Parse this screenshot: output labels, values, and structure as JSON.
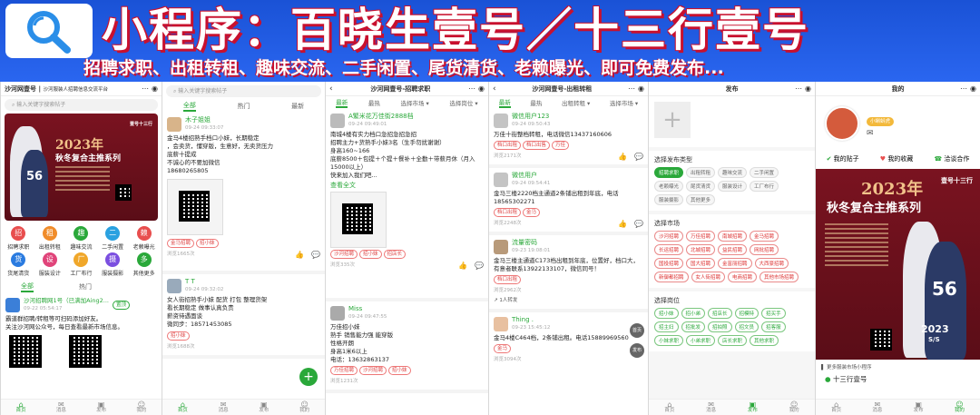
{
  "banner": {
    "headline": "小程序：百晓生壹号／十三行壹号",
    "subline": "招聘求职、出租转租、趣味交流、二手闲置、尾货清货、老赖曝光、即可免费发布..."
  },
  "common": {
    "tabs": [
      "全部",
      "热门",
      "最新"
    ],
    "tabbar": [
      "首页",
      "消息",
      "发布",
      "我的"
    ],
    "like_icon": "👍",
    "comment_icon": "💬"
  },
  "p1": {
    "title": "沙河网壹号",
    "title_sep": "|",
    "title_rest": "沙河服装人招聘信息交流平台",
    "search_placeholder": "输入关键字搜索帖子",
    "poster": {
      "year": "2023年",
      "headline": "秋冬复合主推系列",
      "brand": "壹号十三行",
      "number": "56"
    },
    "grid": [
      {
        "label": "招聘求职",
        "color": "#e84e4e",
        "icon": "招"
      },
      {
        "label": "出租转租",
        "color": "#f08c2a",
        "icon": "租"
      },
      {
        "label": "趣味交流",
        "color": "#2aa83a",
        "icon": "趣"
      },
      {
        "label": "二手闲置",
        "color": "#2aa1e0",
        "icon": "二"
      },
      {
        "label": "老赖曝光",
        "color": "#e84e4e",
        "icon": "赖"
      },
      {
        "label": "货尾清货",
        "color": "#2a7be0",
        "icon": "货"
      },
      {
        "label": "服装设计",
        "color": "#e0447a",
        "icon": "设"
      },
      {
        "label": "工厂布行",
        "color": "#f0a72a",
        "icon": "厂"
      },
      {
        "label": "服装摄影",
        "color": "#7b4fe0",
        "icon": "摄"
      },
      {
        "label": "其他更多",
        "color": "#2aa83a",
        "icon": "多"
      }
    ],
    "tabs": [
      "全部",
      "热门"
    ],
    "post": {
      "name": "沙河招聘网1号（已满加Aing2...",
      "badge": "置顶",
      "time": "09-22 05:54:17",
      "line1": "霸道群招聘/转租等可扫码添加好友。",
      "line2": "关注沙河网公众号，每日查看最新市场信息。"
    }
  },
  "p2": {
    "search_placeholder": "输入关键字搜索帖子",
    "post1": {
      "name": "木子姐姐",
      "time": "09-24 09:33:07",
      "lines": [
        "金马4楼招熟手档口小妹，长期稳定",
        "，会卖货，懂穿版，生意好，无卖货压力",
        "底薪十提成",
        "不诚心的不要加微信",
        "18680265805"
      ],
      "tags": [
        "金马招聘",
        "招小妹"
      ],
      "views": "浏览1665次"
    },
    "post2": {
      "name": "T T",
      "time": "09-24 09:32:02",
      "lines": [
        "女人街招熟手小妹 配货 打包 整理货架",
        "看长期稳定 做事认真负责",
        "薪资待遇面谈",
        "微同步：18571453085"
      ],
      "tags": [
        "招小妹"
      ],
      "views": "浏览1688次"
    }
  },
  "p3": {
    "title": "沙河网壹号-招聘求职",
    "tabs": [
      "最新",
      "最热",
      "选择市场",
      "选择岗位"
    ],
    "post1": {
      "name": "A繁米花万佳街2888档",
      "time": "09-24 09:49:01",
      "lines": [
        "南城4楼有实力档口急招急招急招",
        "招聘主力+货熟手小妹3名（生手勿扰谢谢）",
        "身高160~166",
        "底薪8500＋包提＋个提＋餐补＋全勤＋带薪月休（月入15000以上）",
        "快来加入我们吧..."
      ],
      "more": "查看全文",
      "tags": [
        "沙河招聘",
        "招小妹",
        "招店长"
      ],
      "views": "浏览335次"
    },
    "post2": {
      "name": "Miss",
      "time": "09-24 09:47:55",
      "lines": [
        "万佳招小妹",
        "熟手 销售能力强 能穿版",
        "性格开朗",
        "身高1米6以上",
        "电话：13632863137"
      ],
      "tags": [
        "万佳招聘",
        "沙河招聘",
        "招小妹"
      ],
      "views": "浏览1231次"
    }
  },
  "p4": {
    "title": "沙河网壹号-出租转租",
    "tabs": [
      "最新",
      "最热",
      "出租转租",
      "选择市场"
    ],
    "post1": {
      "name": "微信用户123",
      "time": "09-24 09:50:43",
      "text": "万佳十街整档转租，电话微信13437160606",
      "tags": [
        "档口出租",
        "档口出售",
        "万佳"
      ],
      "views": "浏览2171次"
    },
    "post2": {
      "name": "微信用户",
      "time": "09-24 09:54:41",
      "text": "金马三楼2220档主通道2条铺出租到年底，电话18565302271",
      "tags": [
        "档口出租",
        "金马"
      ],
      "views": "浏览2248次"
    },
    "post3": {
      "name": "流量密码",
      "time": "09-23 19:08:01",
      "text": "金马三楼主通道C173档出租到年底，位置好，档口大，有意者联系13922133107，微信同号！",
      "tags": [
        "档口出租"
      ],
      "views": "浏览2962次",
      "extra": "1人转发"
    },
    "post4": {
      "name": "Thing .",
      "time": "09-23 15:45:12",
      "text": "金马4楼C464档，2条铺出租。电话15889969560",
      "tags": [
        "金马"
      ],
      "views": "浏览3094次"
    },
    "side": [
      "首页",
      "发布"
    ]
  },
  "p5": {
    "title": "发布",
    "type_title": "选择发布类型",
    "types": [
      "招聘求职",
      "出租转租",
      "趣味交流",
      "二手闲置",
      "老赖曝光",
      "尾货清货",
      "服装设计",
      "工厂布行",
      "服装摄影",
      "其他更多"
    ],
    "market_title": "选择市场",
    "markets": [
      "沙河招聘",
      "万佳招聘",
      "南城招聘",
      "金马招聘",
      "长运招聘",
      "北城招聘",
      "益民招聘",
      "网批招聘",
      "国投招聘",
      "国大招聘",
      "金富丽招聘",
      "大西豪招聘",
      "新御都招聘",
      "女人街招聘",
      "电商招聘",
      "其他市场招聘"
    ],
    "job_title": "选择岗位",
    "jobs": [
      "招小妹",
      "招小弟",
      "招店长",
      "招模特",
      "招买手",
      "招主妇",
      "招批发",
      "招拍照",
      "招文员",
      "招客服",
      "小妹求职",
      "小弟求职",
      "店长求职",
      "其他求职"
    ]
  },
  "p6": {
    "title": "我的",
    "badge": "小蝌蚪虎",
    "menu": [
      {
        "label": "我的贴子",
        "icon": "✔",
        "color": "#2aa83a"
      },
      {
        "label": "我的收藏",
        "icon": "♥",
        "color": "#e84e4e"
      },
      {
        "label": "洽谈合作",
        "icon": "☎",
        "color": "#2aa83a"
      }
    ],
    "poster": {
      "year": "2023年",
      "headline": "秋冬复合主推系列",
      "brand": "壹号十三行",
      "number": "56",
      "season": "2023",
      "ss": "S/S"
    },
    "more_text": "更多服装市场小程序",
    "app_name": "十三行壹号"
  }
}
